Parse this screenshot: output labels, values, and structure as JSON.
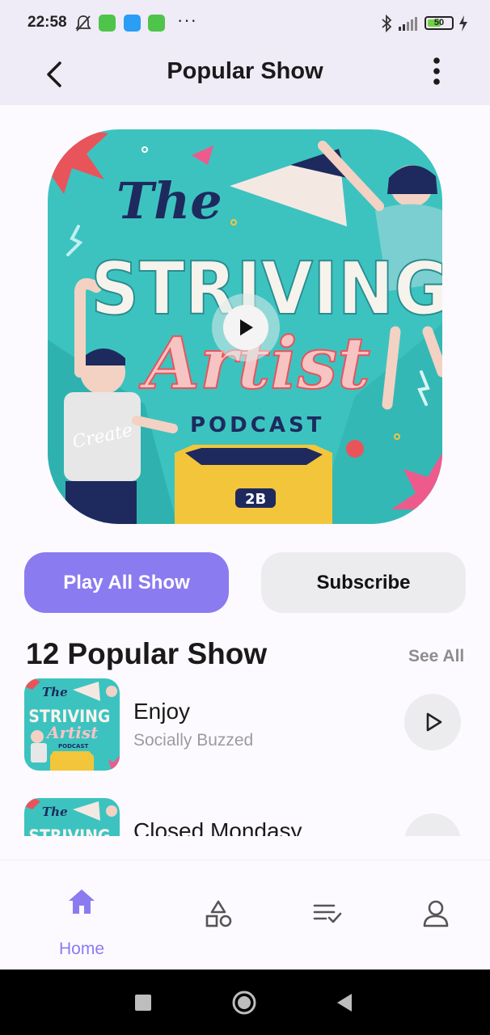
{
  "status_bar": {
    "time": "22:58",
    "battery_level": "50",
    "icons": [
      "mute-bell-icon",
      "app-notification-icon",
      "app-notification-icon",
      "app-notification-icon",
      "bluetooth-icon",
      "signal-icon",
      "battery-icon",
      "charging-icon"
    ],
    "overflow": "···"
  },
  "app_bar": {
    "title": "Popular Show",
    "back_icon": "chevron-left-icon",
    "more_icon": "more-vertical-icon"
  },
  "cover": {
    "line1": "The",
    "line2": "STRIVING",
    "line3": "Artist",
    "line4": "PODCAST",
    "box_label": "2B",
    "shirt_text": "Create",
    "play_icon": "play-icon"
  },
  "actions": {
    "play_all_label": "Play All Show",
    "subscribe_label": "Subscribe"
  },
  "section": {
    "title": "12 Popular Show",
    "see_all": "See All"
  },
  "episodes": [
    {
      "title": "Enjoy",
      "subtitle": "Socially Buzzed"
    },
    {
      "title": "Closed Mondasy",
      "subtitle": ""
    }
  ],
  "bottom_nav": {
    "items": [
      {
        "label": "Home",
        "icon": "home-icon",
        "active": true
      },
      {
        "label": "",
        "icon": "shapes-icon",
        "active": false
      },
      {
        "label": "",
        "icon": "playlist-check-icon",
        "active": false
      },
      {
        "label": "",
        "icon": "profile-icon",
        "active": false
      }
    ]
  },
  "colors": {
    "accent": "#8b7bf0",
    "cover_teal": "#3cc3c0",
    "header_bg": "#efebf7"
  }
}
